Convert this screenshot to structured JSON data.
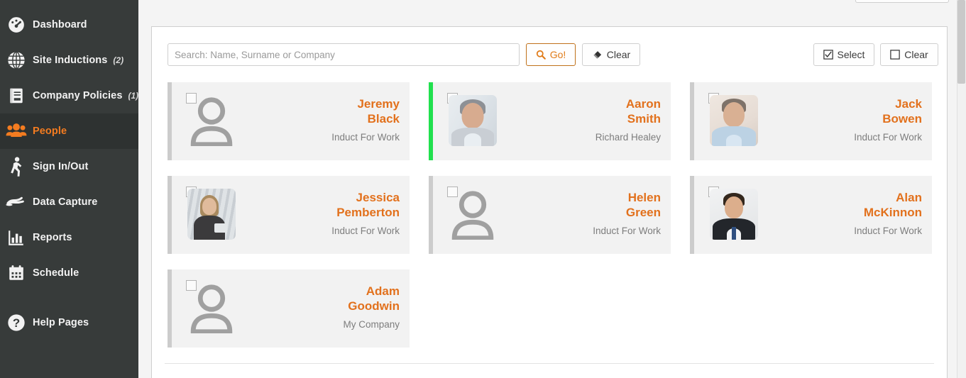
{
  "sidebar": {
    "items": [
      {
        "label": "Dashboard",
        "icon": "gauge-icon",
        "count": "",
        "active": false
      },
      {
        "label": "Site Inductions",
        "icon": "globe-icon",
        "count": "(2)",
        "active": false
      },
      {
        "label": "Company Policies",
        "icon": "book-icon",
        "count": "(1)",
        "active": false
      },
      {
        "label": "People",
        "icon": "people-icon",
        "count": "",
        "active": true
      },
      {
        "label": "Sign In/Out",
        "icon": "walking-icon",
        "count": "",
        "active": false
      },
      {
        "label": "Data Capture",
        "icon": "hand-icon",
        "count": "",
        "active": false
      },
      {
        "label": "Reports",
        "icon": "bar-chart-icon",
        "count": "",
        "active": false
      },
      {
        "label": "Schedule",
        "icon": "calendar-icon",
        "count": "",
        "active": false
      },
      {
        "label": "Help Pages",
        "icon": "question-circle-icon",
        "count": "",
        "active": false
      }
    ],
    "background": "#373b3a",
    "active_background": "#2e3231",
    "active_color": "#f47c20"
  },
  "toolbar": {
    "search_placeholder": "Search: Name, Surname or Company",
    "search_value": "",
    "go_label": "Go!",
    "go_icon": "search-icon",
    "clear_search_label": "Clear",
    "clear_search_icon": "eraser-icon",
    "select_label": "Select",
    "select_icon": "checkbox-checked-icon",
    "clear_selection_label": "Clear",
    "clear_selection_icon": "checkbox-empty-icon",
    "accent": "#e07b18"
  },
  "people": [
    {
      "first": "Jeremy",
      "last": "Black",
      "subtitle": "Induct For Work",
      "avatar": "placeholder",
      "status_color": "#cccccc",
      "checked": false
    },
    {
      "first": "Aaron",
      "last": "Smith",
      "subtitle": "Richard Healey",
      "avatar": "photo-man-grey-hair",
      "status_color": "#21e04e",
      "checked": false
    },
    {
      "first": "Jack",
      "last": "Bowen",
      "subtitle": "Induct For Work",
      "avatar": "photo-man-blue-shirt",
      "status_color": "#cccccc",
      "checked": false
    },
    {
      "first": "Jessica",
      "last": "Pemberton",
      "subtitle": "Induct For Work",
      "avatar": "photo-woman-tablet",
      "status_color": "#cccccc",
      "checked": false
    },
    {
      "first": "Helen",
      "last": "Green",
      "subtitle": "Induct For Work",
      "avatar": "placeholder",
      "status_color": "#cccccc",
      "checked": false
    },
    {
      "first": "Alan",
      "last": "McKinnon",
      "subtitle": "Induct For Work",
      "avatar": "photo-man-suit-tie",
      "status_color": "#cccccc",
      "checked": false
    },
    {
      "first": "Adam",
      "last": "Goodwin",
      "subtitle": "My Company",
      "avatar": "placeholder",
      "status_color": "#cccccc",
      "checked": false
    }
  ]
}
